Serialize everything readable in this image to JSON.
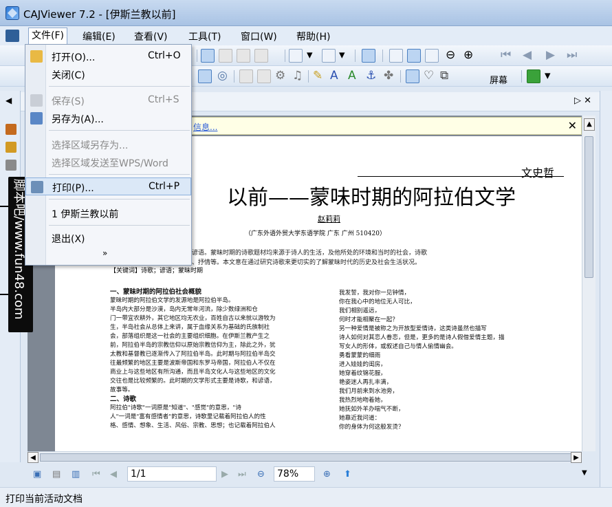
{
  "window": {
    "title": "CAJViewer 7.2 - [伊斯兰教以前]"
  },
  "menubar": {
    "items": [
      "文件(F)",
      "编辑(E)",
      "查看(V)",
      "工具(T)",
      "窗口(W)",
      "帮助(H)"
    ]
  },
  "file_menu": {
    "items": [
      {
        "label": "打开(O)...",
        "shortcut": "Ctrl+O"
      },
      {
        "label": "关闭(C)",
        "shortcut": ""
      },
      {
        "label": "保存(S)",
        "shortcut": "Ctrl+S"
      },
      {
        "label": "另存为(A)...",
        "shortcut": ""
      },
      {
        "label": "选择区域另存为...",
        "shortcut": ""
      },
      {
        "label": "选择区域发送至WPS/Word",
        "shortcut": ""
      },
      {
        "label": "打印(P)...",
        "shortcut": "Ctrl+P"
      },
      {
        "label": "1 伊斯兰教以前",
        "shortcut": ""
      },
      {
        "label": "退出(X)",
        "shortcut": ""
      }
    ],
    "more_glyph": "»"
  },
  "toolbar": {
    "screen_label": "屏幕"
  },
  "info_bar": {
    "link_text": "信息..."
  },
  "watermark": {
    "text": "脚本吧/www.fun48.com"
  },
  "document": {
    "journal": "文史哲",
    "title": "以前——蒙味时期的阿拉伯文学",
    "author": "赵莉莉",
    "affiliation": "（广东外语外贸大学东语学院   广东  广州  510420）",
    "abstract_1": "式主要是诗歌和谚语。蒙昧时期的诗歌题材均来源于诗人的生活，及他所处的环境和当时的社会，诗歌",
    "abstract_2": "悟、讽刺、哀挽、抒情等。本文意在通过研究诗歌来更切实的了解蒙昧时代的历史及社会生活状况。",
    "keywords": "【关键词】诗歌；谚语；蒙昧时期",
    "left_column": [
      "一、蒙昧时期的阿拉伯社会概貌",
      "蒙昧时期的阿拉伯文学的发源地是阿拉伯半岛。",
      "半岛内大部分是沙漠，岛内无常年河流，除少数绿洲和仓",
      "门一带宜农耕外，其它地区均无农业，百姓自古以来就以游牧为",
      "生，半岛社会从总体上来讲，属于血缘关系为基础的氏族制社",
      "会，部落组织是这一社会的主要组织细胞。在伊斯兰教产生之",
      "前，阿拉伯半岛的宗教信仰以原始宗教信仰为主，除此之外，犹",
      "太教和基督教已逐渐传入了阿拉伯半岛。此时期与阿拉伯半岛交",
      "往最频繁的地区主要是波斯帝国和东罗马帝国，阿拉伯人不仅在",
      "商业上与这些地区有所沟通，而且半岛文化人与这些地区的文化",
      "交往也是比较频繁的。此时期的文学形式主要是诗歌，和谚语，",
      "故事等。",
      "二、诗歌",
      "阿拉伯\"诗歌\"一词原是\"知道\"、\"感觉\"的意思，\"诗",
      "人\"一词是\"富有感情者\"的意思，诗歌里记载着阿拉伯人的性",
      "格、感情、想象、生活、风俗、宗教、思想；也记载着阿拉伯人"
    ],
    "right_column": [
      "我发誓，我对你一见钟情，",
      "你在我心中的地位无人可比，",
      "我们相别遥远，",
      "何时才能相聚在一起？",
      "另一种爱情是被称之为开放型爱情诗，这类诗虽然也描写",
      "诗人如何对其恋人眷恋，但是，更多的是诗人假借爱情主题，描",
      "写女人的形体，或叙述自己与情人偷情幽会。",
      "勇看蒙蒙的细雨",
      "进入娃娃的闺房，",
      "她穿着纹锦花服，",
      "艳姿迷人再扎丰满，",
      "我们月前来到水池旁，",
      "我热烈地吻着她，",
      "她抚如外羊办喘气不断，",
      "她靠近我问道：",
      "你的身体为何这般发烫？"
    ]
  },
  "navigation": {
    "page": "1/1",
    "zoom": "78%"
  },
  "statusbar": {
    "text": "打印当前活动文档"
  },
  "colors": {
    "link": "#2a5bd8",
    "menu_highlight": "#dbe8f7",
    "watermark_bg": "#0c0c0c"
  }
}
